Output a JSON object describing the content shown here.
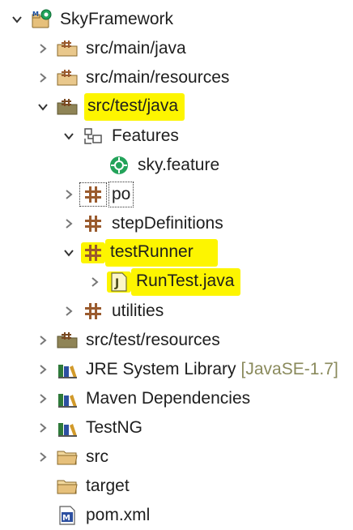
{
  "tree": {
    "project": {
      "label": "SkyFramework"
    },
    "nodes": {
      "src_main_java": "src/main/java",
      "src_main_resources": "src/main/resources",
      "src_test_java": "src/test/java",
      "features": "Features",
      "sky_feature": "sky.feature",
      "po": "po",
      "step_definitions": "stepDefinitions",
      "test_runner": "testRunner",
      "run_test": "RunTest.java",
      "utilities": "utilities",
      "src_test_resources": "src/test/resources",
      "jre_library": "JRE System Library",
      "jre_version": "[JavaSE-1.7]",
      "maven_deps": "Maven Dependencies",
      "testng": "TestNG",
      "src": "src",
      "target": "target",
      "pom": "pom.xml"
    }
  },
  "icons": {
    "project": "maven-project-icon",
    "source_folder": "source-folder-icon",
    "folder": "folder-icon",
    "package": "package-icon",
    "feature_file": "cucumber-feature-icon",
    "java_file": "java-file-icon",
    "library": "library-icon",
    "maven_file": "maven-pom-icon"
  },
  "colors": {
    "highlight": "#fdf500",
    "package_brown": "#9a5b2e",
    "folder_tan": "#e6c07b",
    "cucumber_green": "#23a35a",
    "decoration_text": "#8a8a5c"
  }
}
